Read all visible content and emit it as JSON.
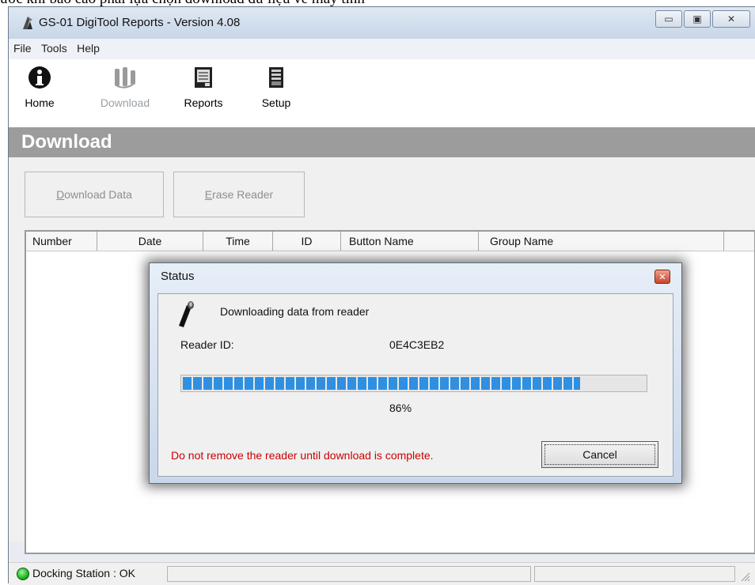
{
  "caption_text": "ước khi báo cáo phải lựa chọn download dữ liệu về máy tính",
  "window": {
    "title": "GS-01 DigiTool Reports - Version 4.08",
    "controls": {
      "minimize": "▭",
      "maximize": "▣",
      "close": "✕"
    }
  },
  "menu": [
    "File",
    "Tools",
    "Help"
  ],
  "toolbar": {
    "home": "Home",
    "download": "Download",
    "reports": "Reports",
    "setup": "Setup"
  },
  "section_title": "Download",
  "buttons": {
    "download_data": {
      "accel": "D",
      "rest": "ownload Data"
    },
    "erase_reader": {
      "accel": "E",
      "rest": "rase Reader"
    }
  },
  "table": {
    "columns": [
      "Number",
      "Date",
      "Time",
      "ID",
      "Button Name",
      "Group Name"
    ]
  },
  "dialog": {
    "title": "Status",
    "message": "Downloading data from reader",
    "reader_id_label": "Reader ID:",
    "reader_id_value": "0E4C3EB2",
    "progress_percent": 86,
    "progress_text": "86%",
    "warning": "Do not remove the reader until download is complete.",
    "cancel": "Cancel"
  },
  "status_bar": {
    "docking_status": "Docking Station : OK",
    "indicator_color": "#1fb51f"
  },
  "colors": {
    "header_bar": "#9c9c9c",
    "progress": "#2f8fe0",
    "warning_text": "#cc0000"
  }
}
